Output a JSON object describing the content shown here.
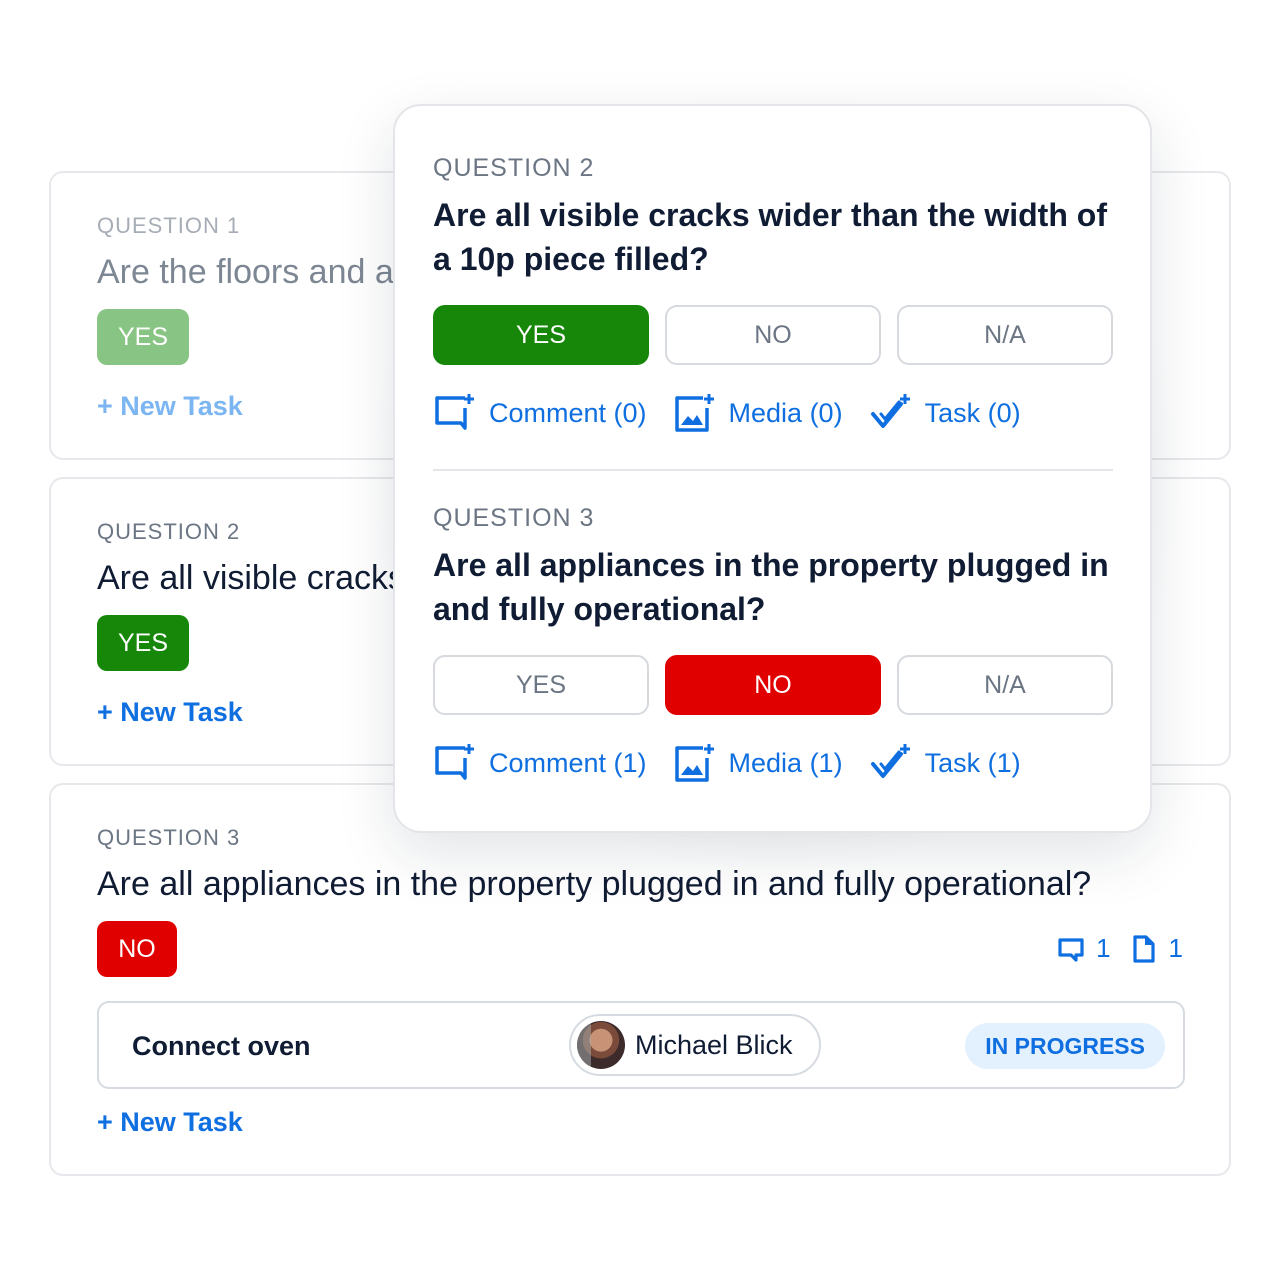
{
  "cards": [
    {
      "label": "QUESTION 1",
      "question": "Are the floors and all surfaces clean and undamaged?",
      "answer": "YES",
      "new_task": "+ New Task"
    },
    {
      "label": "QUESTION 2",
      "question": "Are all visible cracks wider than the width of a 10p piece filled?",
      "answer": "YES",
      "new_task": "+ New Task"
    },
    {
      "label": "QUESTION 3",
      "question": "Are all appliances in the property plugged in and fully operational?",
      "answer": "NO",
      "counts": {
        "comments": "1",
        "files": "1"
      },
      "task": {
        "name": "Connect oven",
        "assignee": "Michael Blick",
        "status": "IN PROGRESS"
      },
      "new_task": "+ New Task"
    }
  ],
  "popup": {
    "questions": [
      {
        "label": "QUESTION 2",
        "text": "Are all visible cracks wider than the width of a 10p piece filled?",
        "options": [
          "YES",
          "NO",
          "N/A"
        ],
        "selected": "YES",
        "actions": {
          "comment": "Comment (0)",
          "media": "Media (0)",
          "task": "Task (0)"
        }
      },
      {
        "label": "QUESTION 3",
        "text": "Are all appliances in the property plugged in and fully operational?",
        "options": [
          "YES",
          "NO",
          "N/A"
        ],
        "selected": "NO",
        "actions": {
          "comment": "Comment (1)",
          "media": "Media (1)",
          "task": "Task (1)"
        }
      }
    ]
  },
  "colors": {
    "yes": "#168709",
    "yes_faded": "#88c483",
    "no": "#e10000",
    "link": "#0f6fe0",
    "status_bg": "#e3f0fd"
  }
}
